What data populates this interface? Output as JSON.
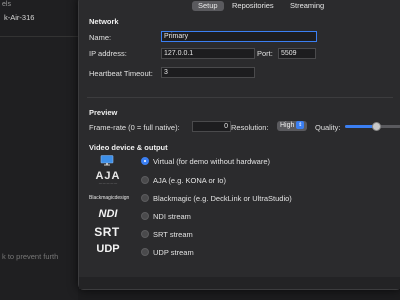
{
  "background_window": {
    "label_partial": "els",
    "host_partial": "k-Air-316",
    "hint_partial": "k to prevent furth"
  },
  "tabs": [
    {
      "label": "Setup",
      "active": true
    },
    {
      "label": "Repositories",
      "active": false
    },
    {
      "label": "Streaming",
      "active": false
    }
  ],
  "network": {
    "title": "Network",
    "name_label": "Name:",
    "name_value": "Primary",
    "ip_label": "IP address:",
    "ip_value": "127.0.0.1",
    "port_label": "Port:",
    "port_value": "5509",
    "heartbeat_label": "Heartbeat Timeout:",
    "heartbeat_value": "3"
  },
  "preview": {
    "title": "Preview",
    "framerate_label": "Frame-rate (0 = full native):",
    "framerate_value": "0",
    "resolution_label": "Resolution:",
    "resolution_value": "High",
    "quality_label": "Quality:",
    "quality_level": 0.55
  },
  "video": {
    "title": "Video device & output",
    "options": [
      {
        "label": "Virtual (for demo without hardware)",
        "icon": "display-icon",
        "selected": true
      },
      {
        "label": "AJA (e.g. KONA or Io)",
        "icon": "aja-logo",
        "logo_text": "AJA",
        "selected": false
      },
      {
        "label": "Blackmagic (e.g. DeckLink or UltraStudio)",
        "icon": "blackmagic-logo",
        "logo_text": "Blackmagicdesign",
        "selected": false
      },
      {
        "label": "NDI stream",
        "icon": "ndi-logo",
        "logo_text": "NDI",
        "selected": false
      },
      {
        "label": "SRT stream",
        "icon": "srt-logo",
        "logo_text": "SRT",
        "selected": false
      },
      {
        "label": "UDP stream",
        "icon": "udp-logo",
        "logo_text": "UDP",
        "selected": false
      }
    ]
  },
  "colors": {
    "accent": "#3b7ff2",
    "panel": "#2b2b2d",
    "field": "#1d1d1f"
  }
}
